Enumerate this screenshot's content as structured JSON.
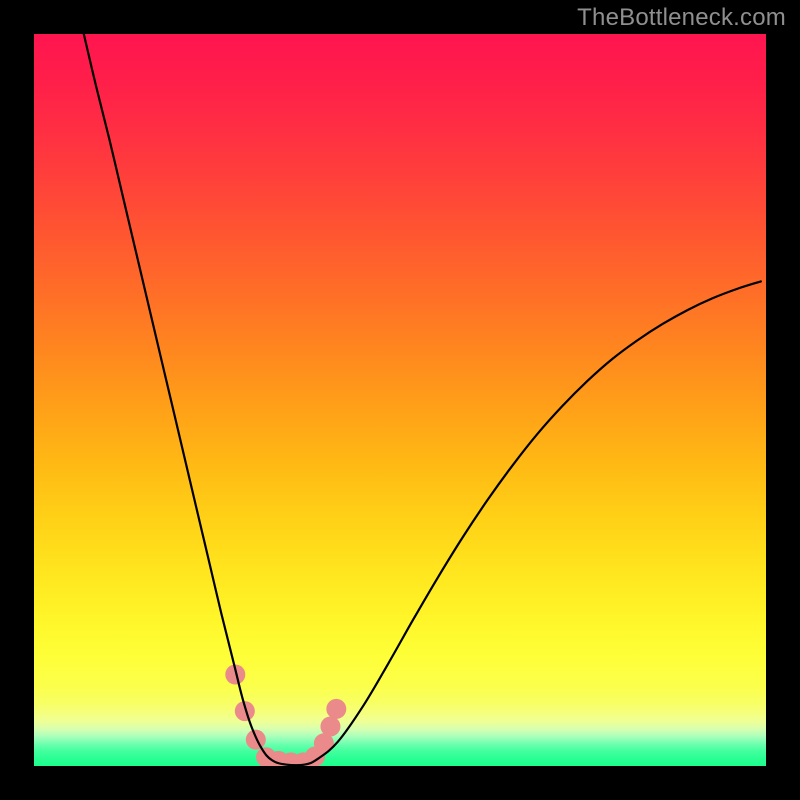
{
  "watermark": "TheBottleneck.com",
  "chart_data": {
    "type": "line",
    "title": "",
    "xlabel": "",
    "ylabel": "",
    "xlim": [
      0,
      100
    ],
    "ylim": [
      0,
      100
    ],
    "grid": false,
    "legend": false,
    "background_gradient_stops": [
      {
        "offset": 0.0,
        "color": "#ff1550"
      },
      {
        "offset": 0.06,
        "color": "#ff1e4a"
      },
      {
        "offset": 0.13,
        "color": "#ff2e43"
      },
      {
        "offset": 0.2,
        "color": "#ff413a"
      },
      {
        "offset": 0.27,
        "color": "#ff5531"
      },
      {
        "offset": 0.35,
        "color": "#ff6d28"
      },
      {
        "offset": 0.43,
        "color": "#ff861f"
      },
      {
        "offset": 0.51,
        "color": "#ffa018"
      },
      {
        "offset": 0.59,
        "color": "#ffba14"
      },
      {
        "offset": 0.67,
        "color": "#ffd317"
      },
      {
        "offset": 0.74,
        "color": "#ffe71f"
      },
      {
        "offset": 0.8,
        "color": "#fff62a"
      },
      {
        "offset": 0.85,
        "color": "#feff38"
      },
      {
        "offset": 0.89,
        "color": "#fbff4a"
      },
      {
        "offset": 0.913,
        "color": "#f8ff62"
      },
      {
        "offset": 0.928,
        "color": "#f5ff7e"
      },
      {
        "offset": 0.94,
        "color": "#edff99"
      },
      {
        "offset": 0.95,
        "color": "#d5ffb0"
      },
      {
        "offset": 0.958,
        "color": "#b2ffba"
      },
      {
        "offset": 0.965,
        "color": "#8affb6"
      },
      {
        "offset": 0.972,
        "color": "#63ffab"
      },
      {
        "offset": 0.98,
        "color": "#42ff9e"
      },
      {
        "offset": 0.99,
        "color": "#2aff93"
      },
      {
        "offset": 1.0,
        "color": "#1cff8d"
      }
    ],
    "series": [
      {
        "name": "bottleneck-curve",
        "stroke": "#000000",
        "stroke_width": 2.2,
        "x": [
          6.8,
          8.5,
          10.3,
          12.0,
          13.7,
          15.4,
          17.1,
          18.8,
          20.5,
          22.2,
          23.9,
          25.6,
          27.4,
          28.5,
          29.7,
          31.1,
          32.5,
          34.4,
          37.0,
          38.8,
          41.5,
          44.9,
          48.4,
          51.8,
          55.2,
          58.6,
          62.0,
          65.4,
          68.8,
          72.2,
          75.6,
          79.0,
          82.5,
          85.9,
          89.3,
          92.7,
          96.1,
          99.3
        ],
        "y": [
          100.0,
          92.8,
          85.6,
          78.4,
          71.2,
          64.0,
          56.8,
          49.6,
          42.4,
          35.2,
          28.0,
          20.8,
          13.6,
          9.2,
          5.4,
          2.4,
          0.8,
          0.2,
          0.2,
          1.0,
          3.3,
          8.1,
          14.0,
          20.0,
          25.8,
          31.3,
          36.4,
          41.1,
          45.4,
          49.2,
          52.6,
          55.6,
          58.2,
          60.4,
          62.3,
          63.9,
          65.2,
          66.2
        ]
      }
    ],
    "markers": {
      "name": "selected-range-dots",
      "fill": "#eb8a8a",
      "radius": 10,
      "points": [
        {
          "x": 27.5,
          "y": 12.5
        },
        {
          "x": 28.8,
          "y": 7.5
        },
        {
          "x": 30.3,
          "y": 3.6
        },
        {
          "x": 31.7,
          "y": 1.2
        },
        {
          "x": 33.4,
          "y": 0.7
        },
        {
          "x": 35.1,
          "y": 0.5
        },
        {
          "x": 36.8,
          "y": 0.5
        },
        {
          "x": 38.4,
          "y": 1.3
        },
        {
          "x": 39.6,
          "y": 3.1
        },
        {
          "x": 40.5,
          "y": 5.4
        },
        {
          "x": 41.3,
          "y": 7.8
        }
      ]
    }
  }
}
